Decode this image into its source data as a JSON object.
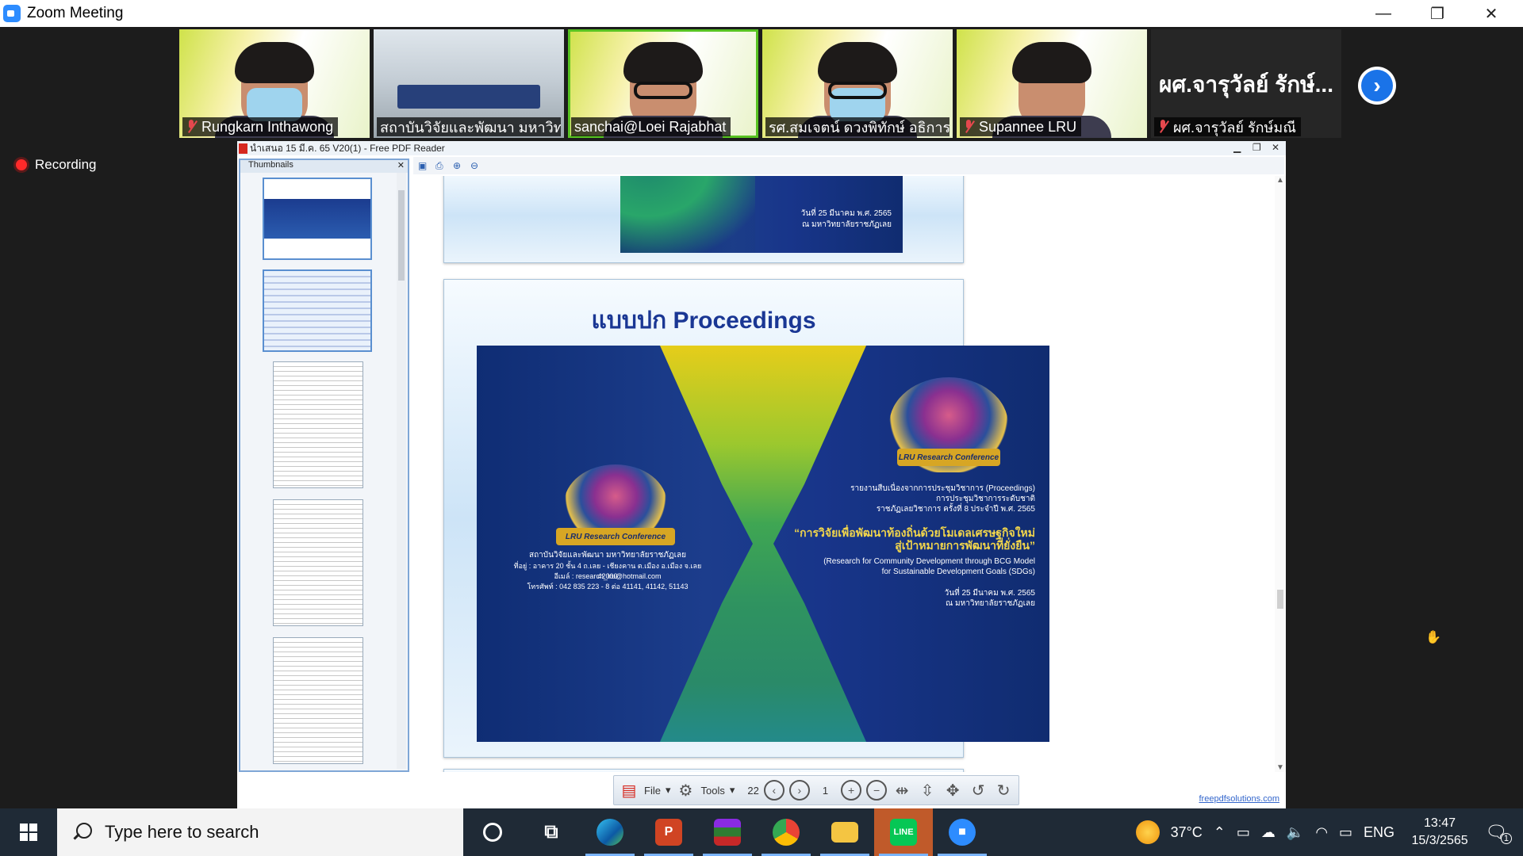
{
  "window": {
    "title": "Zoom Meeting"
  },
  "participants": [
    {
      "name": "Rungkarn Inthawong",
      "muted": true,
      "kind": "mask"
    },
    {
      "name": "สถาบันวิจัยและพัฒนา มหาวิท...",
      "muted": false,
      "kind": "room"
    },
    {
      "name": "sanchai@Loei Rajabhat",
      "muted": false,
      "kind": "glasses",
      "active": true
    },
    {
      "name": "รศ.สมเจตน์ ดวงพิทักษ์ อธิการ...",
      "muted": false,
      "kind": "maskglasses"
    },
    {
      "name": "Supannee LRU",
      "muted": true,
      "kind": "face"
    },
    {
      "name": "ผศ.จารุวัลย์ รักษ์มณี",
      "big_name": "ผศ.จารุวัลย์ รักษ์...",
      "muted": true,
      "kind": "dark"
    }
  ],
  "recording": {
    "label": "Recording"
  },
  "reader": {
    "title": "นำเสนอ 15 มี.ค. 65 V20(1) - Free PDF Reader",
    "thumbnails_label": "Thumbnails",
    "slide_title": "แบบปก Proceedings",
    "top_slide_date": "วันที่ 25 มีนาคม พ.ศ. 2565",
    "top_slide_place": "ณ มหาวิทยาลัยราชภัฏเลย",
    "cover": {
      "ribbon": "LRU Research Conference",
      "right_1": "รายงานสืบเนื่องจากการประชุมวิชาการ (Proceedings)",
      "right_2": "การประชุมวิชาการระดับชาติ",
      "right_3": "ราชภัฏเลยวิชาการ ครั้งที่ 8 ประจำปี พ.ศ. 2565",
      "theme_1": "“การวิจัยเพื่อพัฒนาท้องถิ่นด้วยโมเดลเศรษฐกิจใหม่",
      "theme_2": "สู่เป้าหมายการพัฒนาที่ยั่งยืน”",
      "theme_en_1": "(Research for Community Development through BCG Model",
      "theme_en_2": "for Sustainable Development Goals (SDGs)",
      "date": "วันที่ 25 มีนาคม พ.ศ. 2565",
      "place": "ณ มหาวิทยาลัยราชภัฏเลย",
      "left_1": "สถาบันวิจัยและพัฒนา มหาวิทยาลัยราชภัฏเลย",
      "left_2": "ที่อยู่ : อาคาร 20 ชั้น 4 ถ.เลย - เชียงคาน ต.เมือง อ.เมือง จ.เลย 42000",
      "left_3": "อีเมล์ : research_lru@hotmail.com",
      "left_4": "โทรศัพท์ : 042 835 223 - 8 ต่อ 41141, 41142, 51143"
    },
    "toolbar": {
      "file": "File",
      "tools": "Tools",
      "total_pages": "22",
      "page": "1"
    },
    "footer_link": "freepdfsolutions.com"
  },
  "taskbar": {
    "search_placeholder": "Type here to search",
    "weather": "37°C",
    "lang": "ENG",
    "time": "13:47",
    "date": "15/3/2565",
    "notification_count": "1"
  }
}
